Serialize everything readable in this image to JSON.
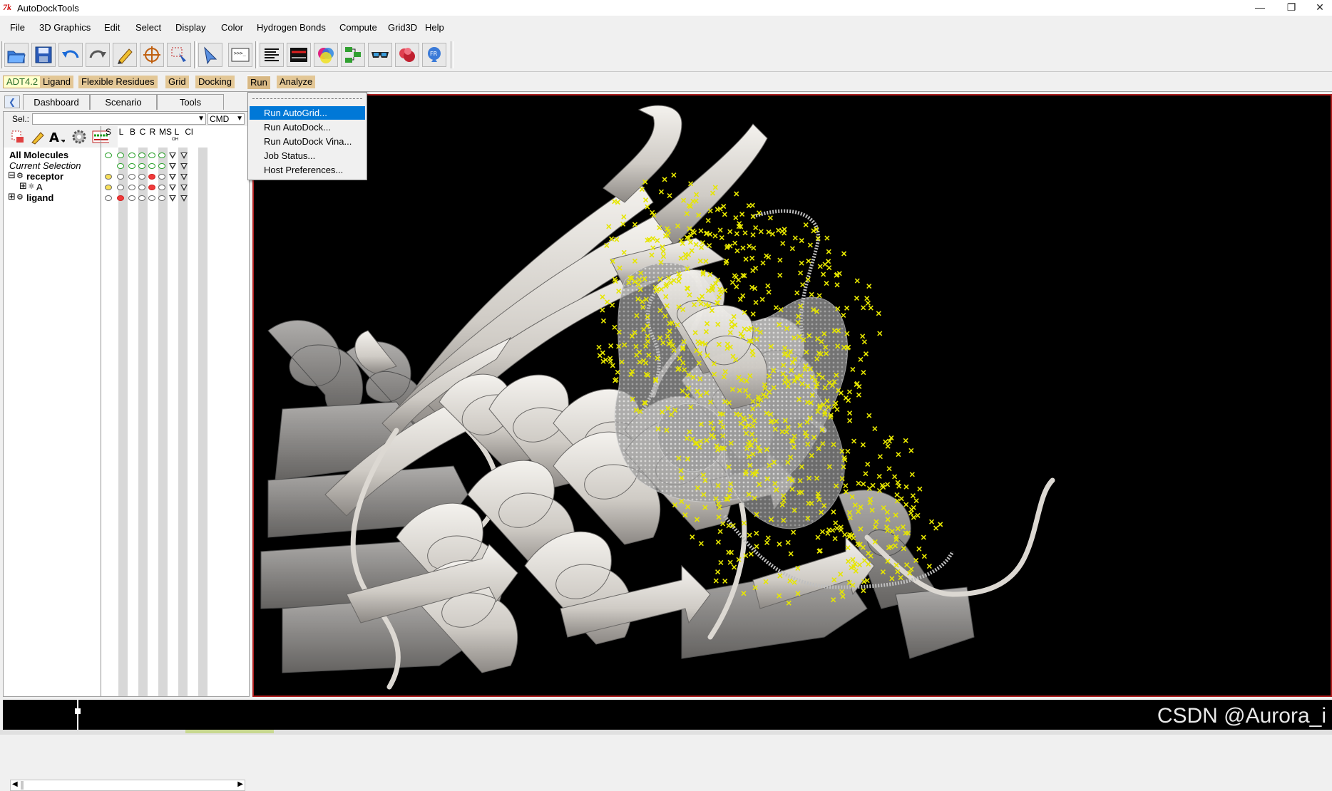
{
  "window": {
    "app_icon": "tk-feather-icon",
    "title": "AutoDockTools",
    "controls": [
      "minimize-icon",
      "restore-icon",
      "close-icon"
    ]
  },
  "menubar": [
    "File",
    "3D Graphics",
    "Edit",
    "Select",
    "Display",
    "Color",
    "Hydrogen Bonds",
    "Compute",
    "Grid3D",
    "Help"
  ],
  "toolbar_icons": [
    "open-folder-icon",
    "save-icon",
    "undo-icon",
    "redo-icon",
    "pencil-icon",
    "target-icon",
    "select-icon",
    "pointer-icon",
    "python-shell-icon",
    "text-align-icon",
    "graph-icon",
    "color-cube-icon",
    "flowchart-icon",
    "stereo-glasses-icon",
    "surface-icon",
    "pmv-icon"
  ],
  "modules": [
    "ADT4.2",
    "Ligand",
    "Flexible Residues",
    "Grid",
    "Docking",
    "Run",
    "Analyze"
  ],
  "dashboard": {
    "tabs": [
      "Dashboard",
      "Scenario",
      "Tools"
    ],
    "sel_label": "Sel.:",
    "sel_value": "",
    "cmd_value": "CMD",
    "columns": [
      "S",
      "L",
      "B",
      "C",
      "R",
      "MS",
      "L",
      "Cl"
    ],
    "column_sub": [
      "OH"
    ],
    "tree": {
      "all_molecules": "All Molecules",
      "current_selection": "Current Selection",
      "receptor": "receptor",
      "chain_a": "A",
      "ligand": "ligand"
    }
  },
  "run_menu": {
    "items": [
      "Run AutoGrid...",
      "Run AutoDock...",
      "Run AutoDock Vina...",
      "Job Status...",
      "Host Preferences..."
    ],
    "highlighted": 0
  },
  "watermark": "CSDN @Aurora_i",
  "colors": {
    "viewer_bg": "#000000",
    "viewer_border": "#b02020",
    "menu_highlight": "#0078d7",
    "module_tab": "#e3c796",
    "ribbon": "#e6e2dc",
    "docking_points": "#e6e600"
  }
}
